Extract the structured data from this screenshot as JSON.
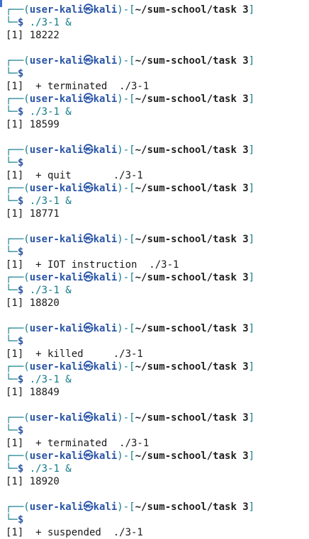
{
  "prompt": {
    "user": "user-kali",
    "symbol": "㉿",
    "host": "kali",
    "path": "~/sum-school/task 3",
    "dollar": "$"
  },
  "lines": [
    {
      "type": "prompt-top"
    },
    {
      "type": "prompt-cmd",
      "cmd": "./3-1 &"
    },
    {
      "type": "output",
      "text": "[1] 18222"
    },
    {
      "type": "blank"
    },
    {
      "type": "prompt-top"
    },
    {
      "type": "prompt-cmd",
      "cmd": ""
    },
    {
      "type": "output",
      "text": "[1]  + terminated  ./3-1"
    },
    {
      "type": "prompt-top"
    },
    {
      "type": "prompt-cmd",
      "cmd": "./3-1 &"
    },
    {
      "type": "output",
      "text": "[1] 18599"
    },
    {
      "type": "blank"
    },
    {
      "type": "prompt-top"
    },
    {
      "type": "prompt-cmd",
      "cmd": ""
    },
    {
      "type": "output",
      "text": "[1]  + quit       ./3-1"
    },
    {
      "type": "prompt-top"
    },
    {
      "type": "prompt-cmd",
      "cmd": "./3-1 &"
    },
    {
      "type": "output",
      "text": "[1] 18771"
    },
    {
      "type": "blank"
    },
    {
      "type": "prompt-top"
    },
    {
      "type": "prompt-cmd",
      "cmd": ""
    },
    {
      "type": "output",
      "text": "[1]  + IOT instruction  ./3-1"
    },
    {
      "type": "prompt-top"
    },
    {
      "type": "prompt-cmd",
      "cmd": "./3-1 &"
    },
    {
      "type": "output",
      "text": "[1] 18820"
    },
    {
      "type": "blank"
    },
    {
      "type": "prompt-top"
    },
    {
      "type": "prompt-cmd",
      "cmd": ""
    },
    {
      "type": "output",
      "text": "[1]  + killed     ./3-1"
    },
    {
      "type": "prompt-top"
    },
    {
      "type": "prompt-cmd",
      "cmd": "./3-1 &"
    },
    {
      "type": "output",
      "text": "[1] 18849"
    },
    {
      "type": "blank"
    },
    {
      "type": "prompt-top"
    },
    {
      "type": "prompt-cmd",
      "cmd": ""
    },
    {
      "type": "output",
      "text": "[1]  + terminated  ./3-1"
    },
    {
      "type": "prompt-top"
    },
    {
      "type": "prompt-cmd",
      "cmd": "./3-1 &"
    },
    {
      "type": "output",
      "text": "[1] 18920"
    },
    {
      "type": "blank"
    },
    {
      "type": "prompt-top"
    },
    {
      "type": "prompt-cmd",
      "cmd": ""
    },
    {
      "type": "output",
      "text": "[1]  + suspended  ./3-1"
    }
  ],
  "colors": {
    "prompt_frame": "#0f7a8a",
    "user_host": "#2a55a6",
    "path": "#222222",
    "command": "#0f7a8a",
    "output": "#1a1a1a",
    "background": "#ffffff",
    "window_edge": "#3b6fd1"
  }
}
